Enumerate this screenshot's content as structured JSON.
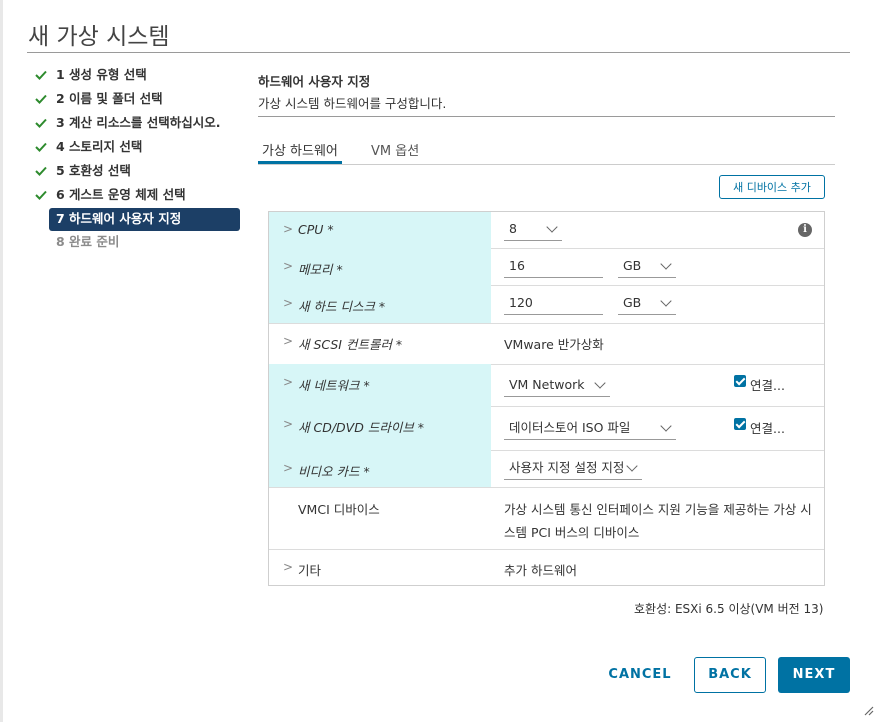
{
  "dialog": {
    "title": "새 가상 시스템"
  },
  "steps": [
    {
      "label": "1 생성 유형 선택",
      "state": "done"
    },
    {
      "label": "2 이름 및 폴더 선택",
      "state": "done"
    },
    {
      "label": "3 계산 리소스를 선택하십시오.",
      "state": "done"
    },
    {
      "label": "4 스토리지 선택",
      "state": "done"
    },
    {
      "label": "5 호환성 선택",
      "state": "done"
    },
    {
      "label": "6 게스트 운영 체제 선택",
      "state": "done"
    },
    {
      "label": "7 하드웨어 사용자 지정",
      "state": "active"
    },
    {
      "label": "8 완료 준비",
      "state": "future"
    }
  ],
  "section": {
    "title": "하드웨어 사용자 지정",
    "subtitle": "가상 시스템 하드웨어를 구성합니다."
  },
  "tabs": [
    {
      "label": "가상 하드웨어",
      "active": true
    },
    {
      "label": "VM 옵션",
      "active": false
    }
  ],
  "add_device_button": "새 디바이스 추가",
  "hardware": {
    "cpu": {
      "name": "CPU *",
      "value": "8"
    },
    "memory": {
      "name": "메모리 *",
      "value": "16",
      "unit": "GB"
    },
    "disk": {
      "name": "새 하드 디스크 *",
      "value": "120",
      "unit": "GB"
    },
    "scsi": {
      "name": "새 SCSI 컨트롤러 *",
      "value": "VMware 반가상화"
    },
    "network": {
      "name": "새 네트워크 *",
      "value": "VM Network",
      "connect_label": "연결...",
      "connected": true
    },
    "cddvd": {
      "name": "새 CD/DVD 드라이브 *",
      "value": "데이터스토어 ISO 파일",
      "connect_label": "연결...",
      "connected": true
    },
    "video": {
      "name": "비디오 카드 *",
      "value": "사용자 지정 설정 지정"
    },
    "vmci": {
      "name": "VMCI 디바이스",
      "desc_line1": "가상 시스템 통신 인터페이스 지원 기능을 제공하는 가상 시",
      "desc_line2": "스템 PCI 버스의 디바이스"
    },
    "other": {
      "name": "기타",
      "value": "추가 하드웨어"
    }
  },
  "compatibility": "호환성: ESXi 6.5 이상(VM 버전 13)",
  "buttons": {
    "cancel": "CANCEL",
    "back": "BACK",
    "next": "NEXT"
  },
  "colors": {
    "accent": "#0072a3",
    "active_step": "#1c3f66",
    "check": "#2e8b2e",
    "label_bg": "#d7f6f7"
  },
  "icons": {
    "done": "check-icon",
    "expand": "chevron-right-icon",
    "info": "info-icon"
  }
}
